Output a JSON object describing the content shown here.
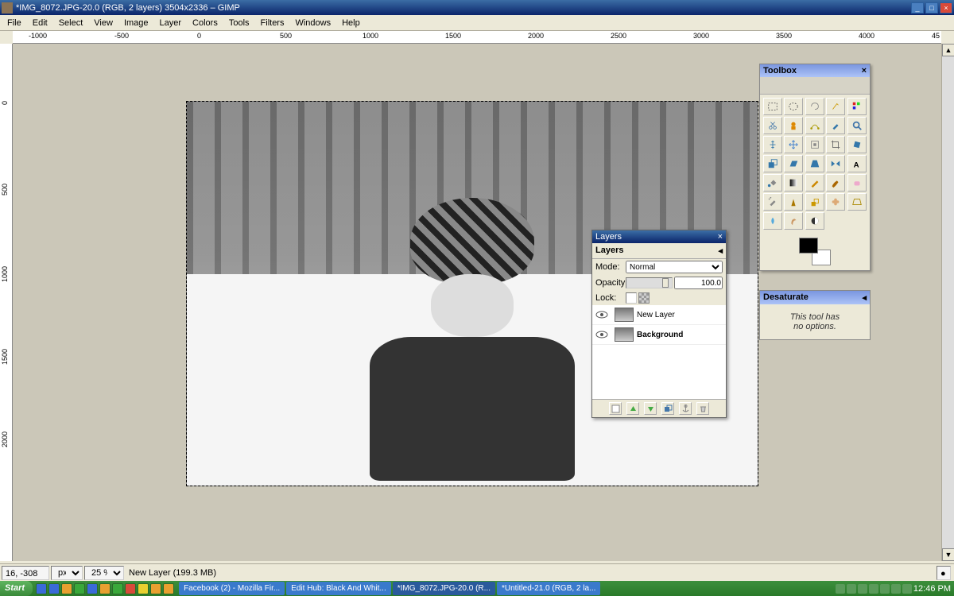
{
  "title": "*IMG_8072.JPG-20.0 (RGB, 2 layers) 3504x2336 – GIMP",
  "menu": [
    "File",
    "Edit",
    "Select",
    "View",
    "Image",
    "Layer",
    "Colors",
    "Tools",
    "Filters",
    "Windows",
    "Help"
  ],
  "ruler_h": [
    "-1000",
    "-500",
    "0",
    "500",
    "1000",
    "1500",
    "2000",
    "2500",
    "3000",
    "3500",
    "4000",
    "45"
  ],
  "ruler_v": [
    "0",
    "500",
    "1000",
    "1500",
    "2000"
  ],
  "status": {
    "coords": "16, -308",
    "unit": "px",
    "zoom": "25 %",
    "msg": "New Layer (199.3 MB)"
  },
  "toolbox": {
    "title": "Toolbox"
  },
  "desaturate": {
    "title": "Desaturate",
    "msg1": "This tool has",
    "msg2": "no options."
  },
  "layers": {
    "title": "Layers",
    "tab": "Layers",
    "mode_lbl": "Mode:",
    "mode_val": "Normal",
    "opacity_lbl": "Opacity:",
    "opacity_val": "100.0",
    "lock_lbl": "Lock:",
    "items": [
      {
        "name": "New Layer",
        "bold": false
      },
      {
        "name": "Background",
        "bold": true
      }
    ]
  },
  "taskbar": {
    "start": "Start",
    "tasks": [
      "Facebook (2) - Mozilla Fir...",
      "Edit Hub: Black And Whit...",
      "*IMG_8072.JPG-20.0 (R...",
      "*Untitled-21.0 (RGB, 2 la..."
    ],
    "clock": "12:46 PM"
  }
}
